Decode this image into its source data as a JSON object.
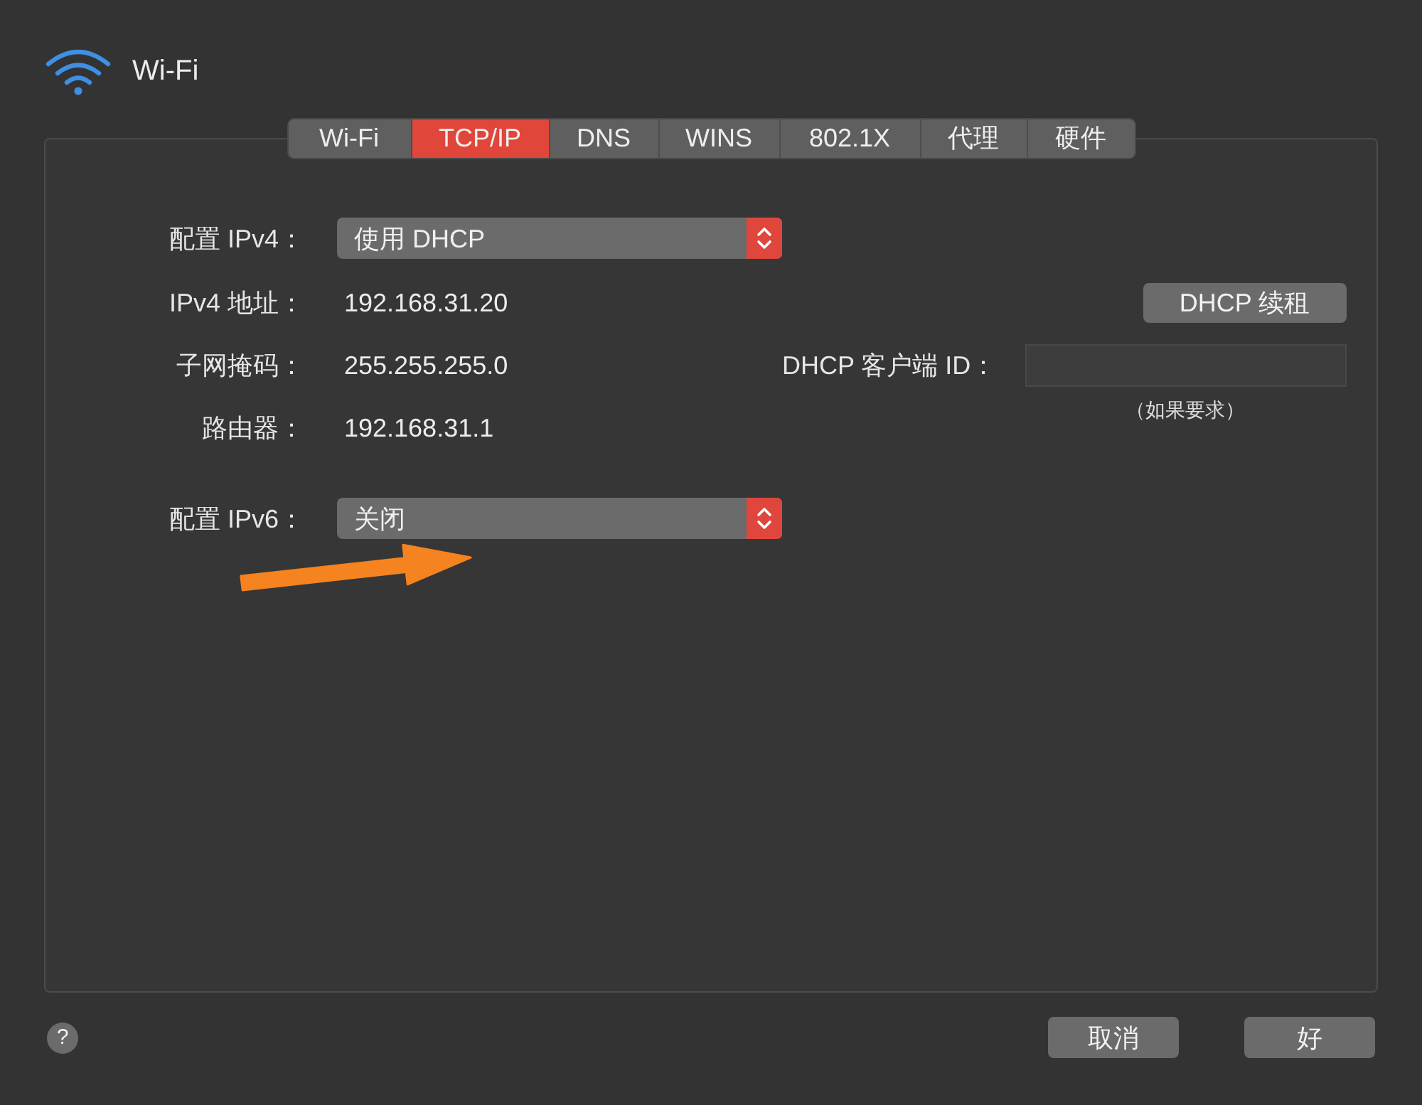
{
  "window": {
    "title": "Wi-Fi"
  },
  "tabs": [
    {
      "label": "Wi-Fi",
      "selected": false
    },
    {
      "label": "TCP/IP",
      "selected": true
    },
    {
      "label": "DNS",
      "selected": false
    },
    {
      "label": "WINS",
      "selected": false
    },
    {
      "label": "802.1X",
      "selected": false
    },
    {
      "label": "代理",
      "selected": false
    },
    {
      "label": "硬件",
      "selected": false
    }
  ],
  "ipv4": {
    "label": "配置 IPv4：",
    "value": "使用 DHCP"
  },
  "details": [
    {
      "label": "IPv4 地址：",
      "value": "192.168.31.20"
    },
    {
      "label": "子网掩码：",
      "value": "255.255.255.0"
    },
    {
      "label": "路由器：",
      "value": "192.168.31.1"
    }
  ],
  "renew_button": {
    "label": "DHCP 续租"
  },
  "client_id": {
    "label": "DHCP 客户端 ID：",
    "note": "（如果要求）"
  },
  "ipv6": {
    "label": "配置 IPv6：",
    "value": "关闭"
  },
  "help_button": {
    "label": "?"
  },
  "buttons": [
    {
      "label": "取消"
    },
    {
      "label": "好"
    }
  ]
}
